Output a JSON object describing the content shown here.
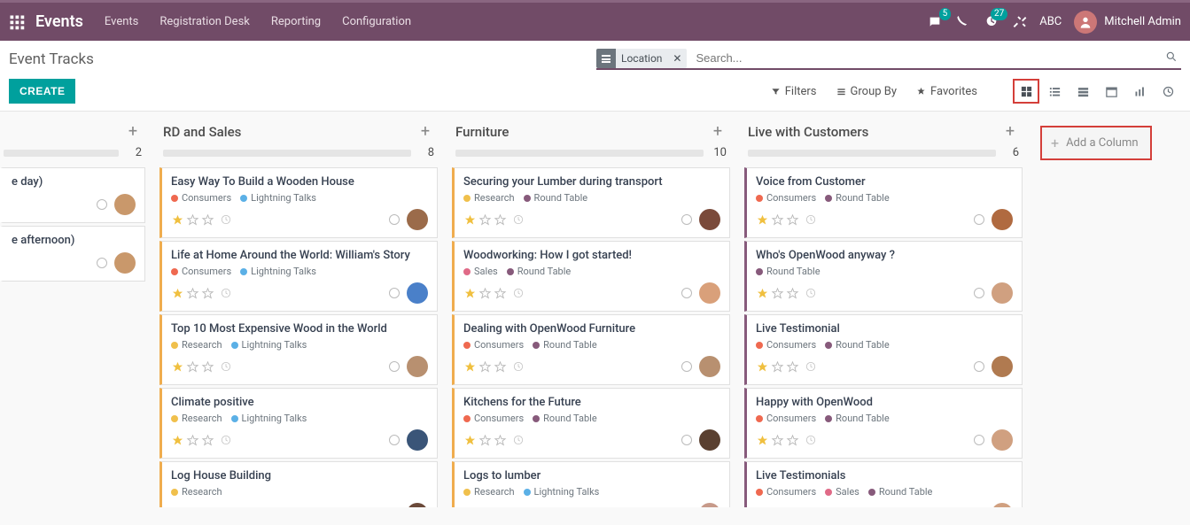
{
  "brand": "Events",
  "nav": [
    "Events",
    "Registration Desk",
    "Reporting",
    "Configuration"
  ],
  "systray": {
    "messages_badge": "5",
    "activities_badge": "27",
    "debug_label": "ABC",
    "user_name": "Mitchell Admin"
  },
  "breadcrumb": "Event Tracks",
  "create_btn": "CREATE",
  "search": {
    "facet_label": "Location",
    "placeholder": "Search..."
  },
  "search_opts": {
    "filters": "Filters",
    "groupby": "Group By",
    "favorites": "Favorites"
  },
  "add_column": "Add a Column",
  "tag_colors": {
    "Consumers": "#ef6950",
    "Lightning Talks": "#5bb0e6",
    "Research": "#f0c04c",
    "Round Table": "#875a7b",
    "Sales": "#e06a87"
  },
  "columns": [
    {
      "title": "",
      "count": "2",
      "partial": true,
      "cards": [
        {
          "title": "e day)",
          "tags": [],
          "star": 0,
          "no_stars": true,
          "avatar_bg": "#c9986b",
          "tiny": true
        },
        {
          "title": "e afternoon)",
          "tags": [],
          "star": 0,
          "no_stars": true,
          "avatar_bg": "#c9986b",
          "tiny": true
        }
      ]
    },
    {
      "title": "RD and Sales",
      "count": "8",
      "cards": [
        {
          "title": "Easy Way To Build a Wooden House",
          "tags": [
            "Consumers",
            "Lightning Talks"
          ],
          "star": 1,
          "avatar_bg": "#9b6b4a",
          "color": "yellow"
        },
        {
          "title": "Life at Home Around the World: William's Story",
          "tags": [
            "Consumers",
            "Lightning Talks"
          ],
          "star": 1,
          "avatar_bg": "#4a80c9",
          "color": "yellow"
        },
        {
          "title": "Top 10 Most Expensive Wood in the World",
          "tags": [
            "Research",
            "Lightning Talks"
          ],
          "star": 1,
          "avatar_bg": "#b89070",
          "color": "yellow"
        },
        {
          "title": "Climate positive",
          "tags": [
            "Research",
            "Lightning Talks"
          ],
          "star": 1,
          "avatar_bg": "#3a5578",
          "color": "yellow"
        },
        {
          "title": "Log House Building",
          "tags": [
            "Research"
          ],
          "star": 1,
          "avatar_bg": "#6b4a3a",
          "color": "yellow"
        }
      ]
    },
    {
      "title": "Furniture",
      "count": "10",
      "cards": [
        {
          "title": "Securing your Lumber during transport",
          "tags": [
            "Research",
            "Round Table"
          ],
          "star": 1,
          "avatar_bg": "#7a4a3a",
          "color": "yellow"
        },
        {
          "title": "Woodworking: How I got started!",
          "tags": [
            "Sales",
            "Round Table"
          ],
          "star": 1,
          "avatar_bg": "#d9a07a",
          "color": "yellow"
        },
        {
          "title": "Dealing with OpenWood Furniture",
          "tags": [
            "Consumers",
            "Round Table"
          ],
          "star": 1,
          "avatar_bg": "#b89070",
          "color": "yellow"
        },
        {
          "title": "Kitchens for the Future",
          "tags": [
            "Consumers",
            "Round Table"
          ],
          "star": 1,
          "avatar_bg": "#5a4030",
          "color": "yellow"
        },
        {
          "title": "Logs to lumber",
          "tags": [
            "Research",
            "Lightning Talks"
          ],
          "star": 1,
          "avatar_bg": "#c79a8a",
          "color": "yellow"
        }
      ]
    },
    {
      "title": "Live with Customers",
      "count": "6",
      "cards": [
        {
          "title": "Voice from Customer",
          "tags": [
            "Consumers",
            "Round Table"
          ],
          "star": 1,
          "avatar_bg": "#b06a40",
          "color": "purple"
        },
        {
          "title": "Who's OpenWood anyway ?",
          "tags": [
            "Round Table"
          ],
          "star": 1,
          "avatar_bg": "#d0a080",
          "color": "purple"
        },
        {
          "title": "Live Testimonial",
          "tags": [
            "Consumers",
            "Round Table"
          ],
          "star": 1,
          "avatar_bg": "#b07a50",
          "color": "purple"
        },
        {
          "title": "Happy with OpenWood",
          "tags": [
            "Consumers",
            "Round Table"
          ],
          "star": 1,
          "avatar_bg": "#d0a080",
          "color": "purple"
        },
        {
          "title": "Live Testimonials",
          "tags": [
            "Consumers",
            "Sales",
            "Round Table"
          ],
          "star": 1,
          "avatar_bg": "#d0a080",
          "color": "purple"
        }
      ]
    }
  ]
}
